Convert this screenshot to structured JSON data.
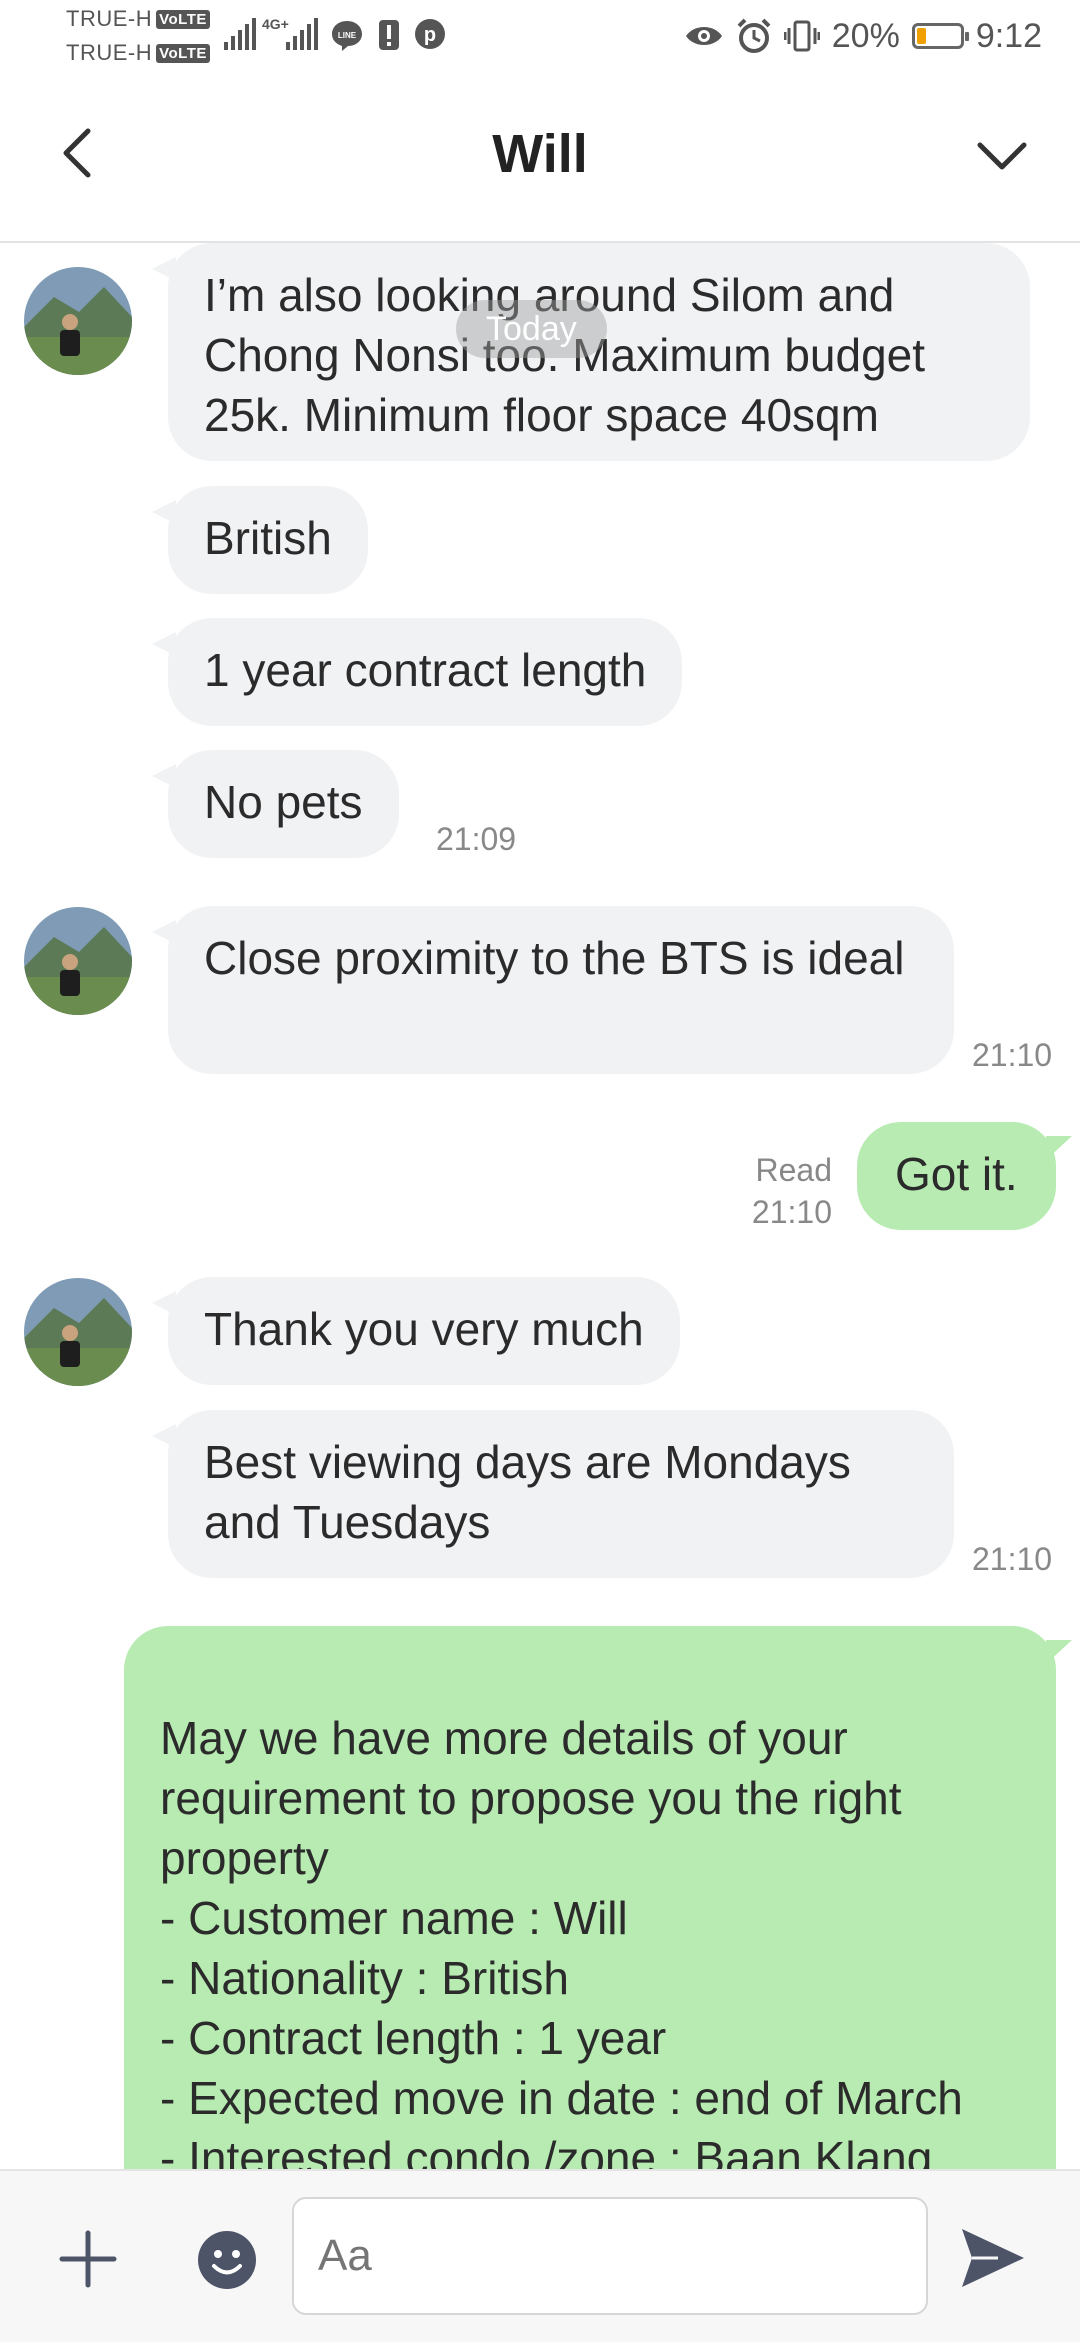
{
  "status": {
    "carrier1": "TRUE-H",
    "carrier2": "TRUE-H",
    "volte": "VoLTE",
    "net_type": "4G+",
    "battery": "20%",
    "time": "9:12",
    "battery_level": 0.2
  },
  "header": {
    "title": "Will"
  },
  "day_separator": "Today",
  "messages": [
    {
      "text": "I’m also looking around Silom and Chong Nonsi too. Maximum budget 25k. Minimum floor space 40sqm",
      "dir": "in"
    },
    {
      "text": "British",
      "dir": "in"
    },
    {
      "text": "1 year contract length",
      "dir": "in"
    },
    {
      "text": "No pets",
      "dir": "in",
      "time": "21:09"
    },
    {
      "text": "Close proximity to the BTS is ideal",
      "dir": "in",
      "time": "21:10"
    },
    {
      "text": "Got it.",
      "dir": "out",
      "read": "Read",
      "time": "21:10"
    },
    {
      "text": "Thank you very much",
      "dir": "in"
    },
    {
      "text": "Best viewing days are Mondays and Tuesdays",
      "dir": "in",
      "time": "21:10"
    },
    {
      "text": "May we have more details of your requirement to propose you the right property\n- Customer name : Will\n- Nationality : British\n- Contract length : 1 year\n- Expected move in date : end of March\n- Interested condo /zone : Baan Klang Krung",
      "dir": "out"
    }
  ],
  "input": {
    "placeholder": "Aa"
  },
  "colors": {
    "incoming_bubble": "#f1f2f4",
    "outgoing_bubble": "#b7ebb2",
    "battery": "#f0a000"
  }
}
